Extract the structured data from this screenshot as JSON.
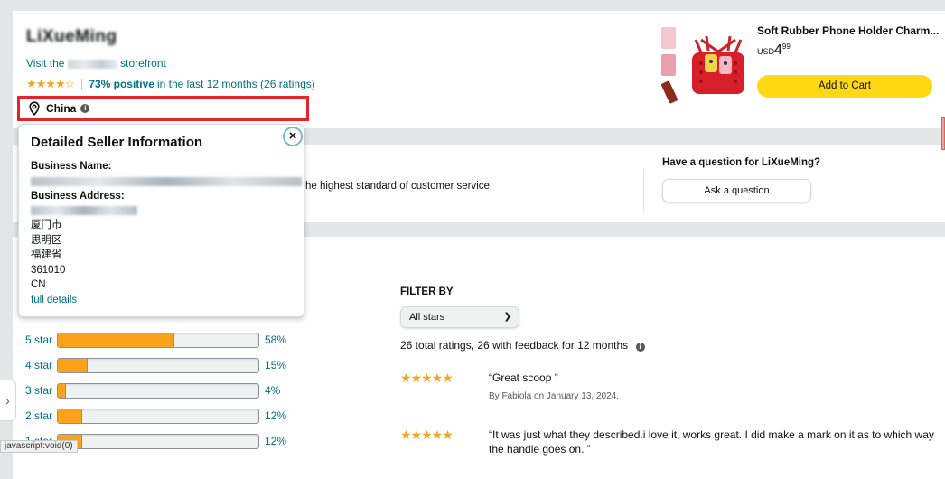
{
  "seller": {
    "name": "LiXueMing",
    "visit_prefix": "Visit the",
    "visit_suffix": "storefront",
    "stars": "★★★★☆",
    "positive": "73% positive",
    "positive_rest": "in the last 12 months (26 ratings)",
    "location": "China"
  },
  "popover": {
    "title": "Detailed Seller Information",
    "close": "×",
    "business_name_label": "Business Name:",
    "business_address_label": "Business Address:",
    "address_lines": [
      "厦门市",
      "思明区",
      "福建省",
      "361010",
      "CN"
    ],
    "full_details": "full details"
  },
  "mid": {
    "text_fragment": "he highest standard of customer service.",
    "question": "Have a question for LiXueMing?",
    "ask_button": "Ask a question"
  },
  "product": {
    "title": "Soft Rubber Phone Holder Charm...",
    "currency": "USD",
    "price_whole": "4",
    "price_fraction": "99",
    "add_to_cart": "Add to Cart"
  },
  "ratings": [
    {
      "label": "5 star",
      "pct": "58%",
      "value": 58
    },
    {
      "label": "4 star",
      "pct": "15%",
      "value": 15
    },
    {
      "label": "3 star",
      "pct": "4%",
      "value": 4
    },
    {
      "label": "2 star",
      "pct": "12%",
      "value": 12
    },
    {
      "label": "1 star",
      "pct": "12%",
      "value": 12
    }
  ],
  "filter": {
    "title": "FILTER BY",
    "selected": "All stars",
    "total": "26 total ratings, 26 with feedback for 12 months"
  },
  "reviews": [
    {
      "stars": "★★★★★",
      "text": "“Great scoop ”",
      "by": "By Fabiola on January 13, 2024."
    },
    {
      "stars": "★★★★★",
      "text": "“It was just what they described.i love it, works great. I did make a mark on it as to which way the handle goes on. ”",
      "by": ""
    }
  ],
  "status_bar": "javascript:void(0)",
  "colors": {
    "accent": "#007185",
    "star": "#f0a71e",
    "cart": "#ffd814",
    "highlight": "#e3242b"
  }
}
